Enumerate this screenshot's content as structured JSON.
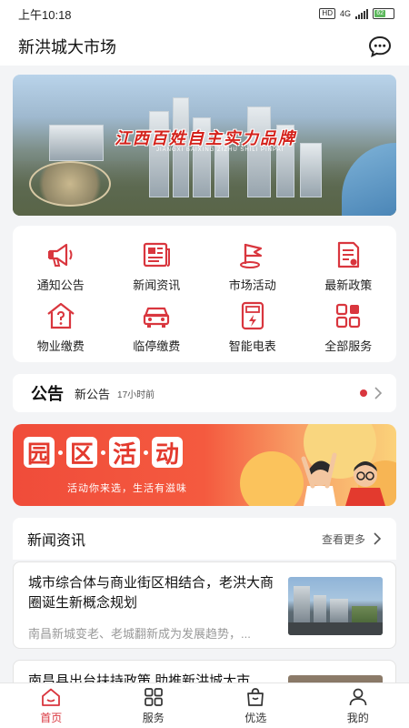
{
  "status_bar": {
    "time": "上午10:18",
    "hd": "HD",
    "network": "4G",
    "battery": "62"
  },
  "header": {
    "title": "新洪城大市场",
    "message_icon": "chat-bubble-icon"
  },
  "banner": {
    "slogan": "江西百姓自主实力品牌",
    "sub": "JIANGXI BAIXING ZIZHU SHILI PINPAI"
  },
  "services": [
    {
      "label": "通知公告",
      "icon": "megaphone-icon"
    },
    {
      "label": "新闻资讯",
      "icon": "newspaper-icon"
    },
    {
      "label": "市场活动",
      "icon": "flag-icon"
    },
    {
      "label": "最新政策",
      "icon": "document-icon"
    },
    {
      "label": "物业缴费",
      "icon": "house-question-icon"
    },
    {
      "label": "临停缴费",
      "icon": "car-icon"
    },
    {
      "label": "智能电表",
      "icon": "electric-meter-icon"
    },
    {
      "label": "全部服务",
      "icon": "grid-icon"
    }
  ],
  "notice": {
    "tag": "公告",
    "text": "新公告",
    "time": "17小时前"
  },
  "activity": {
    "chars": [
      "园",
      "区",
      "活",
      "动"
    ],
    "subline": "活动你来选，生活有滋味"
  },
  "news": {
    "title": "新闻资讯",
    "more": "查看更多",
    "items": [
      {
        "headline": "城市综合体与商业街区相结合，老洪大商圈诞生新概念规划",
        "summary": "南昌新城变老、老城翻新成为发展趋势，..."
      },
      {
        "headline": "南昌县出台扶持政策 助推新洪城大市"
      }
    ]
  },
  "tabbar": {
    "items": [
      {
        "label": "首页",
        "icon": "home-icon",
        "active": true
      },
      {
        "label": "服务",
        "icon": "services-grid-icon",
        "active": false
      },
      {
        "label": "优选",
        "icon": "shopping-bag-icon",
        "active": false
      },
      {
        "label": "我的",
        "icon": "user-icon",
        "active": false
      }
    ]
  },
  "colors": {
    "accent": "#d9363e",
    "background": "#f3f4f6"
  }
}
